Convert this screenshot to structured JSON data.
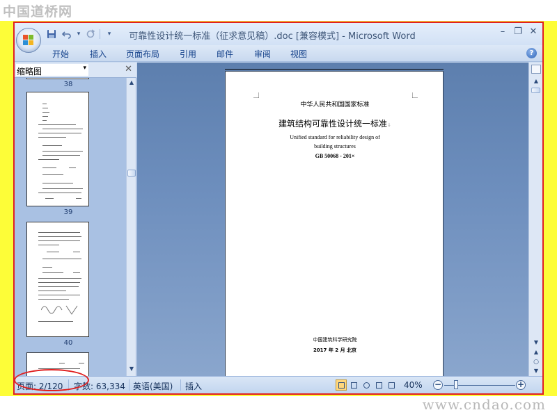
{
  "site": {
    "logo_text": "中国道桥网",
    "url_text": "www.cndao.com"
  },
  "window": {
    "title": "可靠性设计统一标准（征求意见稿）.doc [兼容模式] - Microsoft Word",
    "minimize": "–",
    "restore": "❐",
    "close": "✕"
  },
  "qat": {
    "save": "💾",
    "undo": "↶",
    "undo_dd": "▾",
    "redo": "↷",
    "customize": "▾"
  },
  "ribbon": {
    "tabs": [
      "开始",
      "插入",
      "页面布局",
      "引用",
      "邮件",
      "审阅",
      "视图"
    ],
    "help": "?"
  },
  "thumb_pane": {
    "selector_label": "缩略图",
    "selector_arrow": "▾",
    "close": "✕",
    "page_numbers": [
      "38",
      "39",
      "40"
    ]
  },
  "document": {
    "header_line": "中华人民共和国国家标准",
    "title_cn": "建筑结构可靠性设计统一标准",
    "title_mark": "↓",
    "title_en_1": "Unified standard for reliability design of",
    "title_en_2": "building structures",
    "code": "GB 50068 - 201×",
    "publisher": "中国建筑科学研究院",
    "date": "2017 年 2 月   北京"
  },
  "status": {
    "page": "页面: 2/120",
    "words": "字数: 63,334",
    "language": "英语(美国)",
    "mode": "插入",
    "zoom": "40%",
    "zoom_level": 0.4,
    "zoom_minus": "−",
    "zoom_plus": "+"
  },
  "colors": {
    "annotation_red": "#e02020",
    "frame_yellow": "#fdfd38",
    "ribbon_text": "#15428b"
  }
}
